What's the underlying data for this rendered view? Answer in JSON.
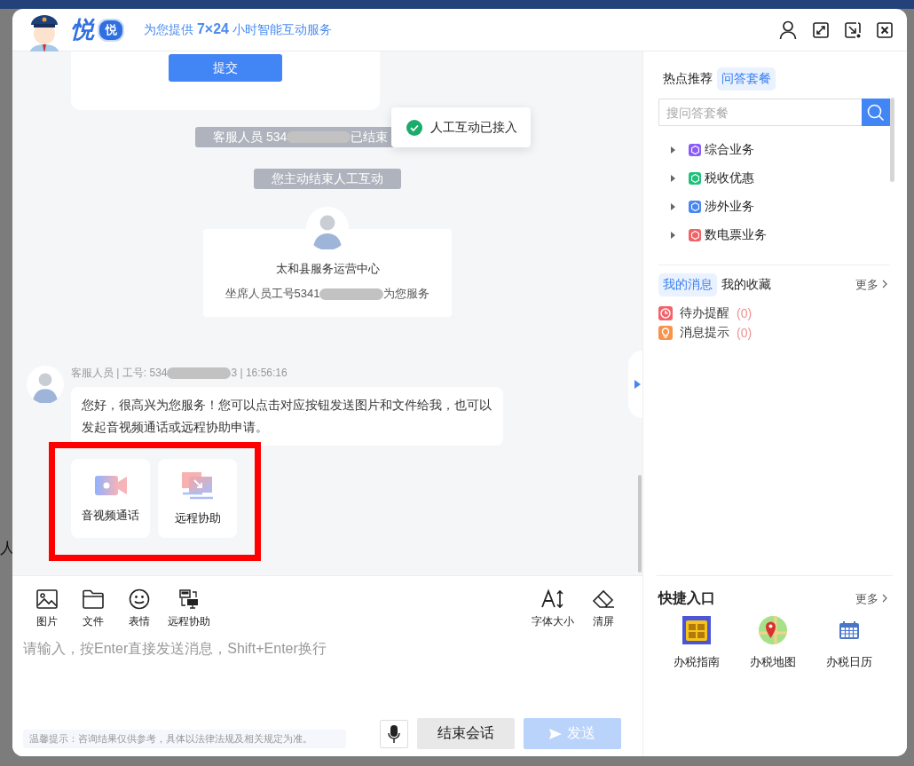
{
  "backdrop": {
    "fragment": "人"
  },
  "header": {
    "logo": "悦",
    "badge": "悦",
    "tagline": "为您提供 **7×24** 小时智能互动服务"
  },
  "chat": {
    "form_card": {
      "submit_button": "提交"
    },
    "notices": [
      {
        "kind": "redacted",
        "parts": [
          "客服人员 534",
          "已结束"
        ]
      },
      {
        "kind": "plain",
        "parts": [
          "您主动结束人工互动"
        ]
      }
    ],
    "agent_card": {
      "org": "太和县服务运营中心",
      "line_parts": [
        "坐席人员工号5341",
        "为您服务"
      ]
    },
    "message": {
      "meta_parts": [
        "客服人员 | 工号: 534",
        "3 | 16:56:16"
      ],
      "text": "您好，很高兴为您服务！您可以点击对应按钮发送图片和文件给我，也可以发起音视频通话或远程协助申请。"
    },
    "actions": [
      {
        "kind": "video",
        "label": "音视频通话"
      },
      {
        "kind": "remote",
        "label": "远程协助"
      }
    ],
    "toast": "人工互动已接入"
  },
  "toolbar": {
    "left": [
      {
        "kind": "image",
        "label": "图片"
      },
      {
        "kind": "file",
        "label": "文件"
      },
      {
        "kind": "emoji",
        "label": "表情"
      },
      {
        "kind": "remote",
        "label": "远程协助"
      }
    ],
    "right": [
      {
        "kind": "fontsize",
        "label": "字体大小"
      },
      {
        "kind": "eraser",
        "label": "清屏"
      }
    ]
  },
  "input": {
    "placeholder": "请输入，按Enter直接发送消息，Shift+Enter换行"
  },
  "footer": {
    "notice": "温馨提示：咨询结果仅供参考，具体以法律法规及相关规定为准。",
    "end_button": "结束会话",
    "send_button": {
      "label": "发送",
      "disabled": true
    }
  },
  "side": {
    "tabs": [
      {
        "label": "热点推荐",
        "selected": false
      },
      {
        "label": "问答套餐",
        "selected": true
      }
    ],
    "search": {
      "placeholder": "搜问答套餐"
    },
    "tree": [
      {
        "label": "综合业务",
        "color": "#8b5cf6",
        "expanded": false
      },
      {
        "label": "税收优惠",
        "color": "#1ec27a",
        "expanded": false
      },
      {
        "label": "涉外业务",
        "color": "#4a86f0",
        "expanded": false
      },
      {
        "label": "数电票业务",
        "color": "#f06468",
        "expanded": false
      }
    ],
    "message_tabs": [
      {
        "label": "我的消息",
        "selected": true
      },
      {
        "label": "我的收藏",
        "selected": false
      }
    ],
    "messages_more": "更多",
    "messages": [
      {
        "kind": "todo",
        "label": "待办提醒",
        "count": "(0)"
      },
      {
        "kind": "tip",
        "label": "消息提示",
        "count": "(0)"
      }
    ],
    "quick": {
      "title": "快捷入口",
      "more": "更多",
      "items": [
        {
          "kind": "guide",
          "label": "办税指南"
        },
        {
          "kind": "map",
          "label": "办税地图"
        },
        {
          "kind": "calendar",
          "label": "办税日历"
        }
      ]
    }
  }
}
